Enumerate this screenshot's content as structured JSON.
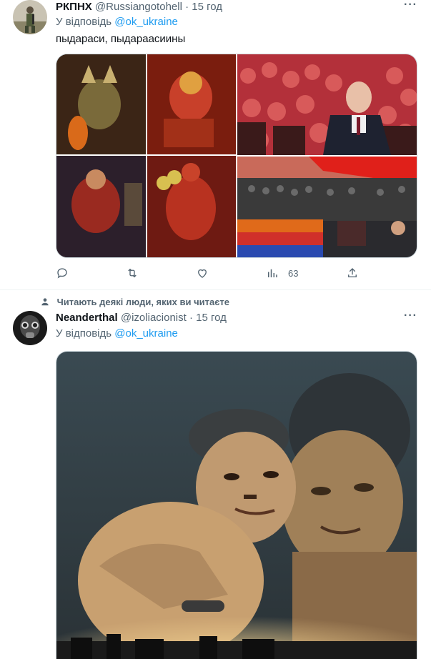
{
  "tweet1": {
    "display_name": "РКПНХ",
    "handle": "@Russiangotohell",
    "dot": "·",
    "time": "15 год",
    "more_icon": "more-horizontal-icon",
    "reply_prefix": "У відповідь",
    "reply_to": "@ok_ukraine",
    "text": "пыдараси, пыдараасиины",
    "actions": {
      "reply_icon": "reply-icon",
      "retweet_icon": "retweet-icon",
      "like_icon": "heart-icon",
      "views_icon": "views-icon",
      "views_count": "63",
      "share_icon": "share-icon"
    }
  },
  "tweet2": {
    "social_context": "Читають деякі люди, яких ви читаєте",
    "social_icon": "person-icon",
    "display_name": "Neanderthal",
    "handle": "@izoliacionist",
    "dot": "·",
    "time": "15 год",
    "more_icon": "more-horizontal-icon",
    "reply_prefix": "У відповідь",
    "reply_to": "@ok_ukraine"
  },
  "colors": {
    "link": "#1d9bf0",
    "secondary_text": "#536471",
    "primary_text": "#0f1419",
    "divider": "#eff3f4"
  }
}
